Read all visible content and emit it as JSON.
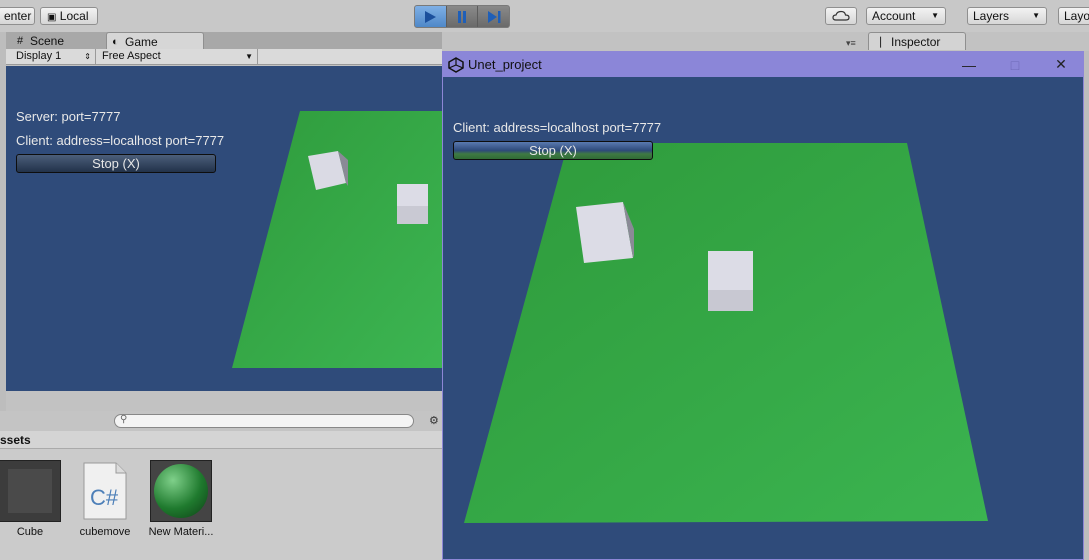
{
  "toolbar": {
    "pivot_label": "enter",
    "space_label": "Local",
    "account_label": "Account",
    "layers_label": "Layers",
    "layout_label": "Layo"
  },
  "tabs": {
    "scene": "Scene",
    "game": "Game",
    "inspector": "Inspector"
  },
  "game_toolbar": {
    "display": "Display 1",
    "aspect": "Free Aspect"
  },
  "server_view": {
    "server_label": "Server: port=7777",
    "client_label": "Client: address=localhost port=7777",
    "stop_button": "Stop (X)"
  },
  "client_window": {
    "title": "Unet_project",
    "client_label": "Client: address=localhost port=7777",
    "stop_button": "Stop (X)"
  },
  "project": {
    "search_placeholder": "",
    "header": "ssets",
    "assets": [
      {
        "name": "Cube",
        "icon": "prefab-icon"
      },
      {
        "name": "cubemove",
        "icon": "csharp-script-icon",
        "glyph": "C#"
      },
      {
        "name": "New Materi...",
        "icon": "material-sphere-icon"
      }
    ]
  },
  "colors": {
    "game_background": "#2f4b7a",
    "ground_green": "#34a845",
    "cube_white": "#dcdce6",
    "titlebar": "#8b86d8"
  }
}
